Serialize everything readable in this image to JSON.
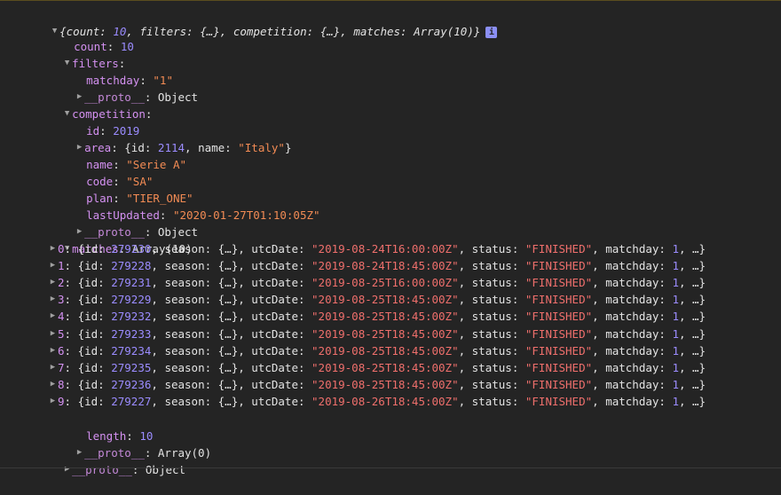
{
  "summary": {
    "pre": "{",
    "count_key": "count",
    "count_val": "10",
    "sep1": ", ",
    "filters_key": "filters",
    "filters_val": "{…}",
    "competition_key": "competition",
    "competition_val": "{…}",
    "matches_key": "matches",
    "matches_val": "Array(10)",
    "post": "}",
    "info": "i"
  },
  "count": {
    "key": "count",
    "value": "10"
  },
  "filters": {
    "key": "filters",
    "matchday_key": "matchday",
    "matchday_val": "\"1\"",
    "proto_key": "__proto__",
    "proto_val": "Object"
  },
  "competition": {
    "key": "competition",
    "id_key": "id",
    "id_val": "2019",
    "area_key": "area",
    "area_pre": "{id: ",
    "area_id": "2114",
    "area_mid": ", name: ",
    "area_name": "\"Italy\"",
    "area_post": "}",
    "name_key": "name",
    "name_val": "\"Serie A\"",
    "code_key": "code",
    "code_val": "\"SA\"",
    "plan_key": "plan",
    "plan_val": "\"TIER_ONE\"",
    "lastUpdated_key": "lastUpdated",
    "lastUpdated_val": "\"2020-01-27T01:10:05Z\"",
    "proto_key": "__proto__",
    "proto_val": "Object"
  },
  "matches": {
    "key": "matches",
    "value": "Array(10)",
    "items": [
      {
        "index": "0",
        "id": "279230",
        "utcDate": "\"2019-08-24T16:00:00Z\"",
        "status": "\"FINISHED\"",
        "matchday": "1"
      },
      {
        "index": "1",
        "id": "279228",
        "utcDate": "\"2019-08-24T18:45:00Z\"",
        "status": "\"FINISHED\"",
        "matchday": "1"
      },
      {
        "index": "2",
        "id": "279231",
        "utcDate": "\"2019-08-25T16:00:00Z\"",
        "status": "\"FINISHED\"",
        "matchday": "1"
      },
      {
        "index": "3",
        "id": "279229",
        "utcDate": "\"2019-08-25T18:45:00Z\"",
        "status": "\"FINISHED\"",
        "matchday": "1"
      },
      {
        "index": "4",
        "id": "279232",
        "utcDate": "\"2019-08-25T18:45:00Z\"",
        "status": "\"FINISHED\"",
        "matchday": "1"
      },
      {
        "index": "5",
        "id": "279233",
        "utcDate": "\"2019-08-25T18:45:00Z\"",
        "status": "\"FINISHED\"",
        "matchday": "1"
      },
      {
        "index": "6",
        "id": "279234",
        "utcDate": "\"2019-08-25T18:45:00Z\"",
        "status": "\"FINISHED\"",
        "matchday": "1"
      },
      {
        "index": "7",
        "id": "279235",
        "utcDate": "\"2019-08-25T18:45:00Z\"",
        "status": "\"FINISHED\"",
        "matchday": "1"
      },
      {
        "index": "8",
        "id": "279236",
        "utcDate": "\"2019-08-25T18:45:00Z\"",
        "status": "\"FINISHED\"",
        "matchday": "1"
      },
      {
        "index": "9",
        "id": "279227",
        "utcDate": "\"2019-08-26T18:45:00Z\"",
        "status": "\"FINISHED\"",
        "matchday": "1"
      }
    ],
    "item_labels": {
      "id_pre": "{id: ",
      "season": ", season: ",
      "season_val": "{…}",
      "utc": ", utcDate: ",
      "status": ", status: ",
      "matchday": ", matchday: ",
      "tail": ", …}",
      "colon": ": "
    },
    "length_key": "length",
    "length_val": "10",
    "proto_key": "__proto__",
    "proto_val": "Array(0)"
  },
  "root_proto": {
    "key": "__proto__",
    "value": "Object"
  },
  "icons": {
    "expanded": "triangle-down-icon",
    "collapsed": "triangle-right-icon",
    "info": "info-icon"
  },
  "colors": {
    "background": "#242424",
    "key": "#d491f1",
    "string": "#f28b54",
    "number": "#9b8cff",
    "text": "#e3e3e3"
  }
}
